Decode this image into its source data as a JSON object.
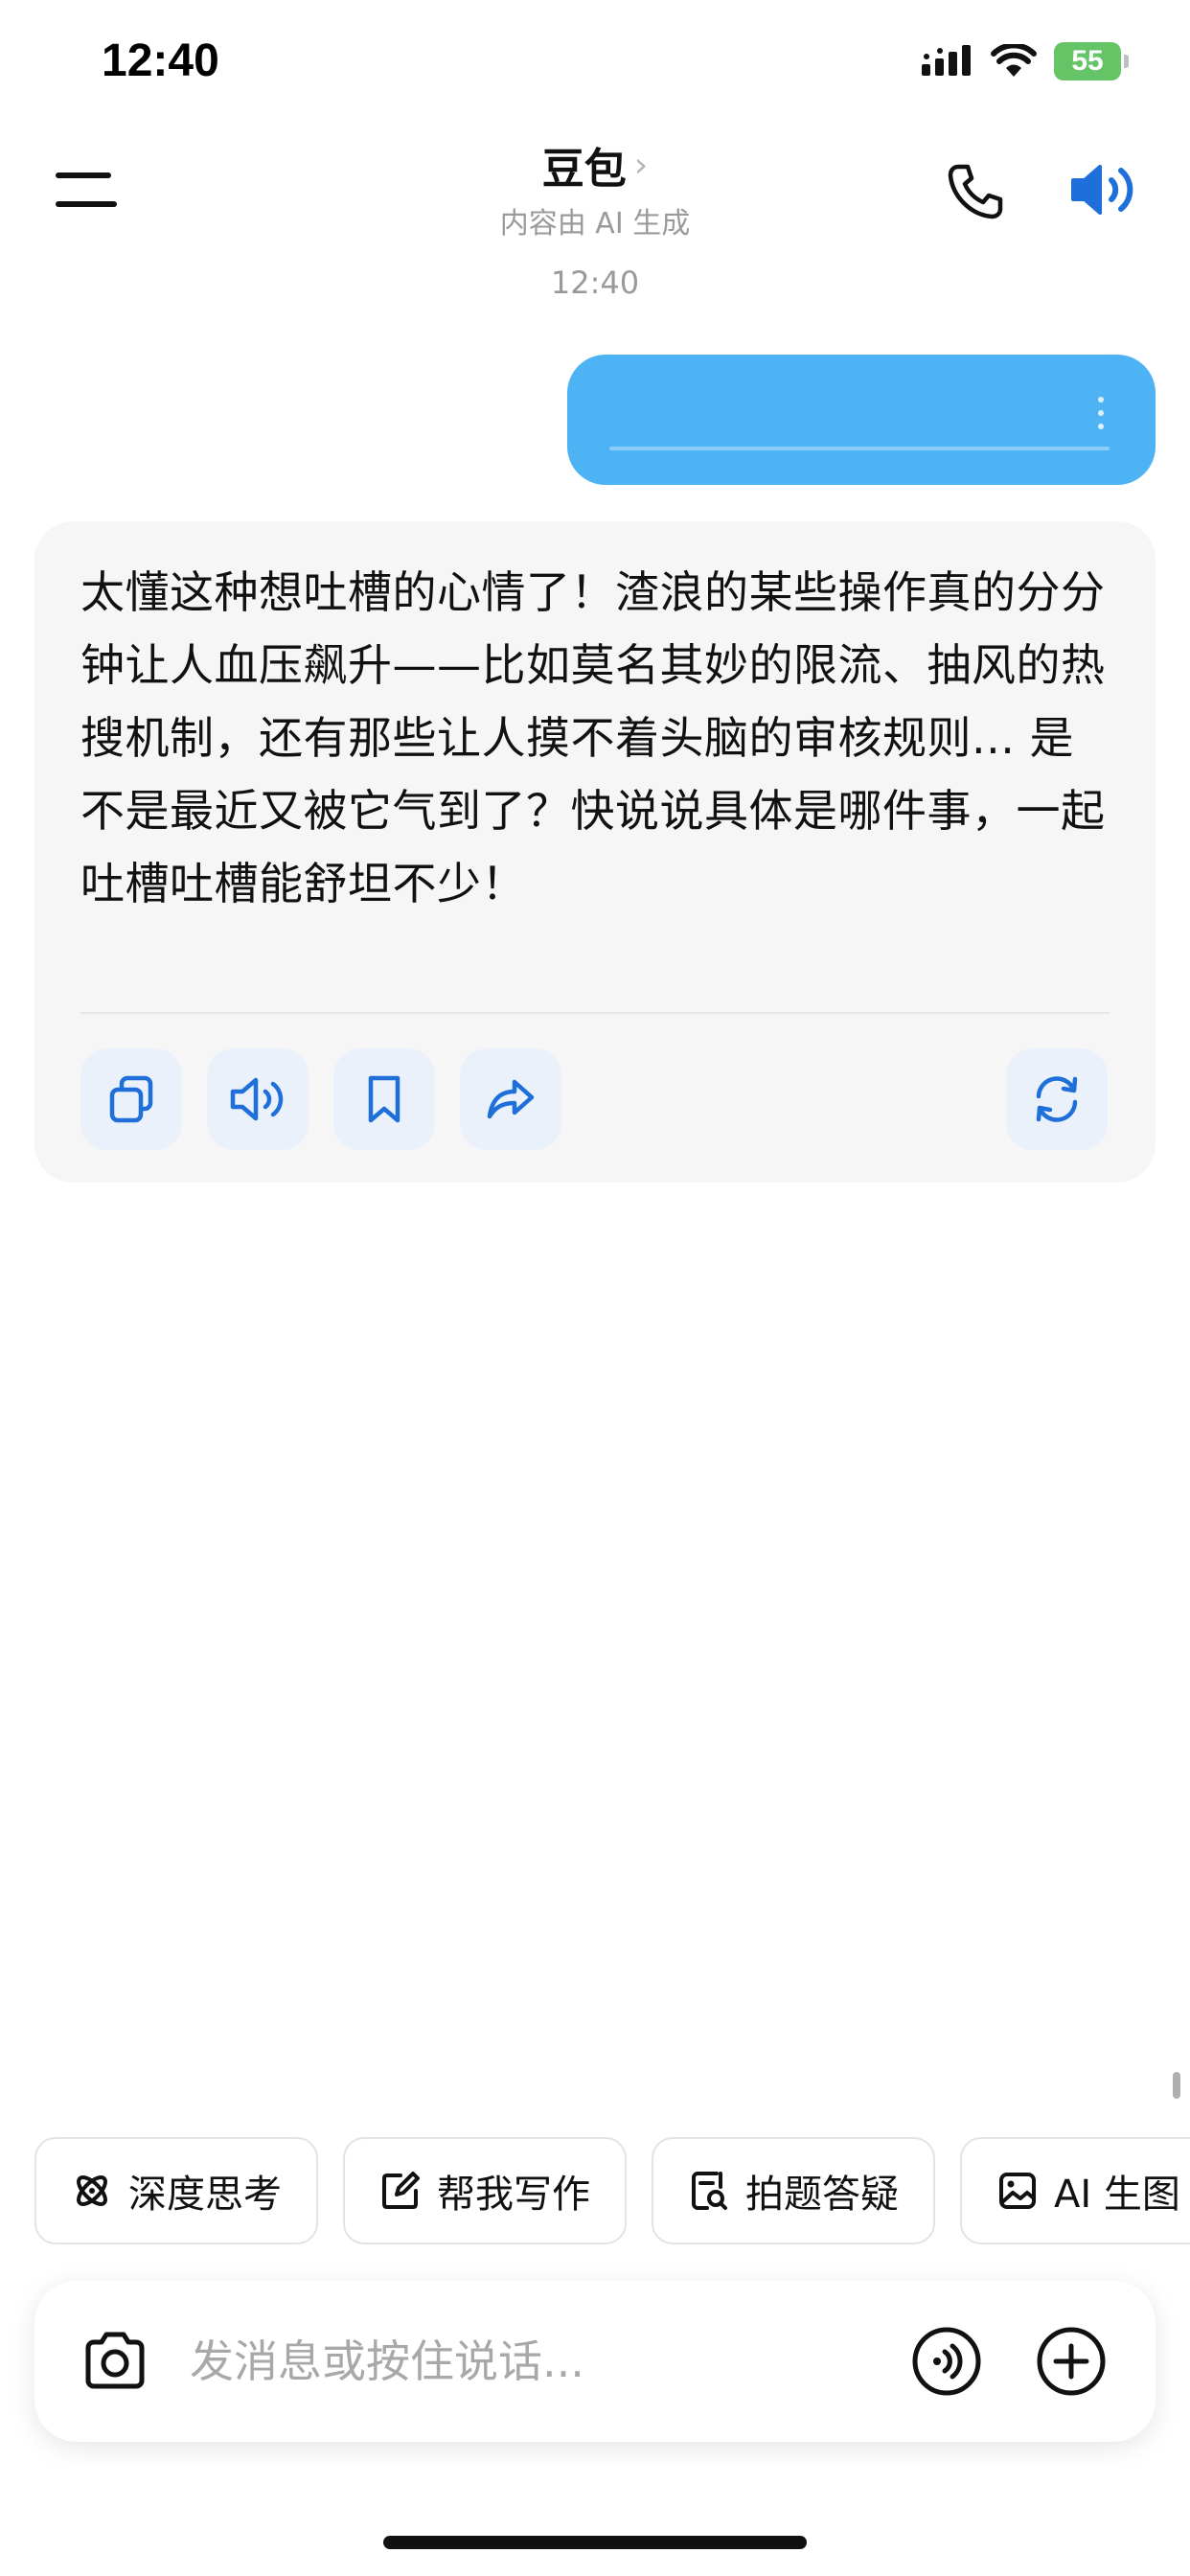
{
  "status_bar": {
    "time": "12:40",
    "battery": "55"
  },
  "header": {
    "title": "豆包",
    "subtitle": "内容由 AI 生成"
  },
  "timestamp": "12:40",
  "ai_message": {
    "text": "太懂这种想吐槽的心情了！渣浪的某些操作真的分分钟让人血压飙升——比如莫名其妙的限流、抽风的热搜机制，还有那些让人摸不着头脑的审核规则... 是不是最近又被它气到了？快说说具体是哪件事，一起吐槽吐槽能舒坦不少！"
  },
  "chips": [
    {
      "label": "深度思考",
      "icon": "atom-icon"
    },
    {
      "label": "帮我写作",
      "icon": "edit-icon"
    },
    {
      "label": "拍题答疑",
      "icon": "doc-search-icon"
    },
    {
      "label": "AI 生图",
      "icon": "image-icon"
    }
  ],
  "input": {
    "placeholder": "发消息或按住说话..."
  },
  "colors": {
    "accent": "#1e6fd9",
    "user_bubble": "#4db3f5",
    "ai_card": "#f6f6f7"
  }
}
